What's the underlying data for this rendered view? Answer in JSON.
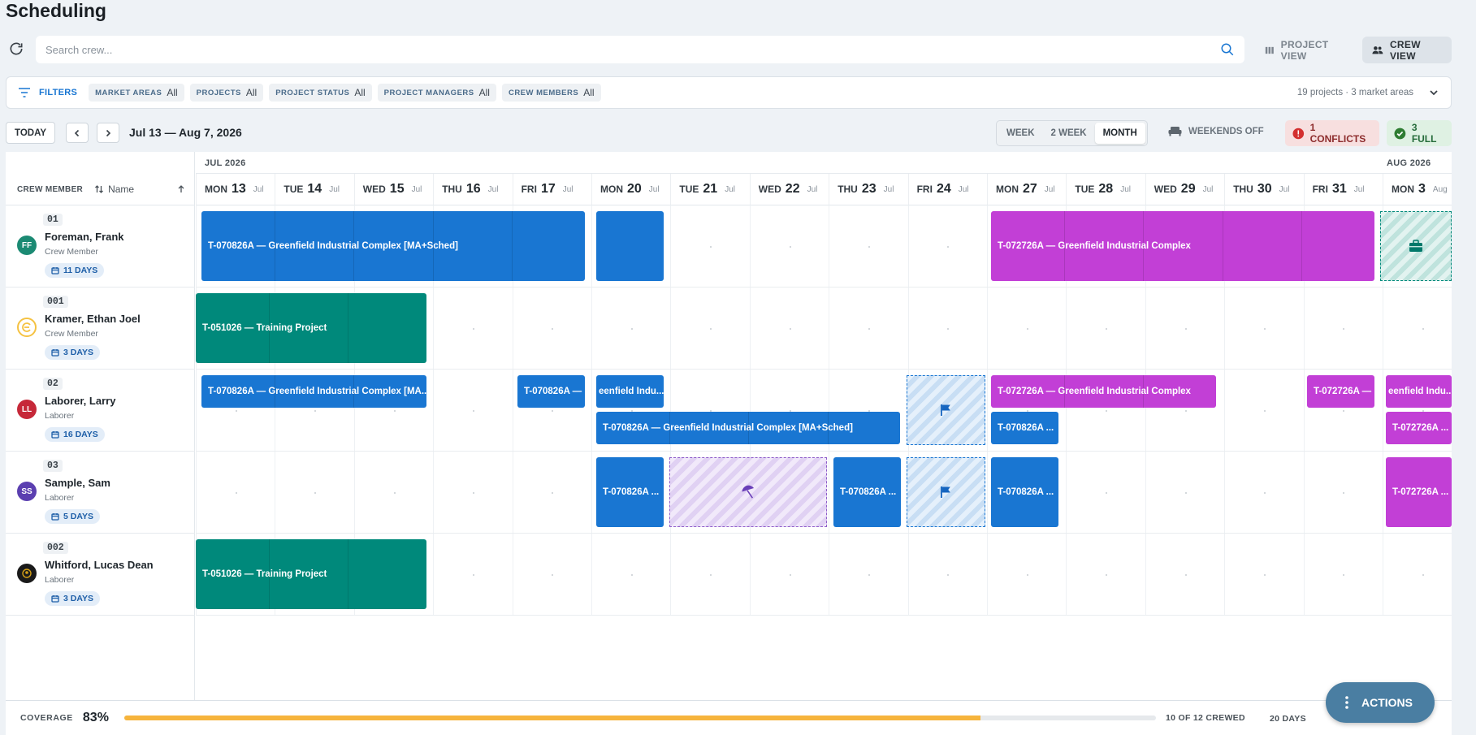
{
  "header": {
    "title": "Scheduling"
  },
  "search": {
    "placeholder": "Search crew..."
  },
  "views": {
    "project_label": "PROJECT VIEW",
    "crew_label": "CREW VIEW",
    "active": "crew"
  },
  "filters": {
    "label": "FILTERS",
    "chips": [
      {
        "key": "MARKET AREAS",
        "value": "All"
      },
      {
        "key": "PROJECTS",
        "value": "All"
      },
      {
        "key": "PROJECT STATUS",
        "value": "All"
      },
      {
        "key": "PROJECT MANAGERS",
        "value": "All"
      },
      {
        "key": "CREW MEMBERS",
        "value": "All"
      }
    ],
    "summary": "19 projects · 3 market areas"
  },
  "toolbar": {
    "today_label": "TODAY",
    "date_range": "Jul 13 — Aug 7, 2026",
    "ranges": [
      "WEEK",
      "2 WEEK",
      "MONTH"
    ],
    "active_range": "MONTH",
    "weekends_label": "WEEKENDS OFF",
    "conflicts_label": "1 CONFLICTS",
    "full_label": "3 FULL"
  },
  "grid": {
    "crew_header": "CREW MEMBER",
    "sort_label": "Name",
    "months": [
      "JUL 2026",
      "AUG 2026"
    ],
    "days": [
      {
        "dow": "MON",
        "date": "13",
        "mon": "Jul"
      },
      {
        "dow": "TUE",
        "date": "14",
        "mon": "Jul"
      },
      {
        "dow": "WED",
        "date": "15",
        "mon": "Jul"
      },
      {
        "dow": "THU",
        "date": "16",
        "mon": "Jul"
      },
      {
        "dow": "FRI",
        "date": "17",
        "mon": "Jul"
      },
      {
        "dow": "MON",
        "date": "20",
        "mon": "Jul"
      },
      {
        "dow": "TUE",
        "date": "21",
        "mon": "Jul"
      },
      {
        "dow": "WED",
        "date": "22",
        "mon": "Jul"
      },
      {
        "dow": "THU",
        "date": "23",
        "mon": "Jul"
      },
      {
        "dow": "FRI",
        "date": "24",
        "mon": "Jul"
      },
      {
        "dow": "MON",
        "date": "27",
        "mon": "Jul"
      },
      {
        "dow": "TUE",
        "date": "28",
        "mon": "Jul"
      },
      {
        "dow": "WED",
        "date": "29",
        "mon": "Jul"
      },
      {
        "dow": "THU",
        "date": "30",
        "mon": "Jul"
      },
      {
        "dow": "FRI",
        "date": "31",
        "mon": "Jul"
      },
      {
        "dow": "MON",
        "date": "3",
        "mon": "Aug"
      }
    ],
    "crew": [
      {
        "num": "01",
        "initials": "FF",
        "avatar_color": "#1b8a73",
        "name": "Foreman, Frank",
        "role": "Crew Member",
        "days": "11 DAYS"
      },
      {
        "num": "001",
        "initials": "",
        "avatar_color": "#f5c242",
        "name": "Kramer, Ethan Joel",
        "role": "Crew Member",
        "days": "3 DAYS"
      },
      {
        "num": "02",
        "initials": "LL",
        "avatar_color": "#c62839",
        "name": "Laborer, Larry",
        "role": "Laborer",
        "days": "16 DAYS"
      },
      {
        "num": "03",
        "initials": "SS",
        "avatar_color": "#5b3fb0",
        "name": "Sample, Sam",
        "role": "Laborer",
        "days": "5 DAYS"
      },
      {
        "num": "002",
        "initials": "",
        "avatar_color": "#1a1a1a",
        "name": "Whitford, Lucas Dean",
        "role": "Laborer",
        "days": "3 DAYS"
      }
    ],
    "assignments": {
      "a1": "T-070826A — Greenfield Industrial Complex [MA+Sched]",
      "a2": "T-072726A — Greenfield Industrial Complex",
      "a3": "T-051026 — Training Project",
      "a4": "T-070826A — Greenfield Industrial Complex [MA...",
      "a5": "T-070826A —",
      "a6": "eenfield Indu...",
      "a7": "T-072726A — Greenfield Industrial Complex",
      "a8": "T-072726A —",
      "a9": "eenfield Indu...",
      "a10": "T-070826A — Greenfield Industrial Complex [MA+Sched]",
      "a11": "T-070826A ...",
      "a12": "T-072726A ...",
      "a13": "T-070826A ...",
      "a14": "T-070826A ...",
      "a15": "T-070826A ...",
      "a16": "T-072726A ...",
      "a17": "T-051026 — Training Project"
    },
    "marker_icons": [
      "briefcase-icon",
      "flag-icon",
      "umbrella-icon"
    ]
  },
  "coverage": {
    "label": "COVERAGE",
    "percent_text": "83%",
    "fill_percent": 83,
    "crewed": "10 OF 12 CREWED",
    "days": "20 DAYS"
  },
  "actions": {
    "label": "ACTIONS"
  }
}
